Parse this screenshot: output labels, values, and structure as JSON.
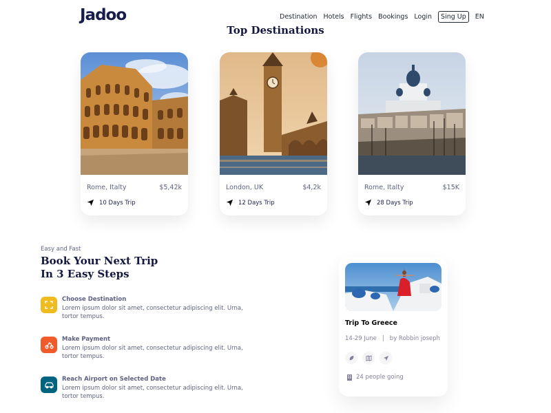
{
  "header": {
    "logo": "Jadoo",
    "nav": [
      "Destination",
      "Hotels",
      "Flights",
      "Bookings",
      "Login",
      "Sing Up",
      "EN"
    ]
  },
  "destinations": {
    "title": "Top Destinations",
    "cards": [
      {
        "place": "Rome, Italty",
        "price": "$5,42k",
        "trip": "10 Days Trip",
        "image": "colosseum"
      },
      {
        "place": "London, UK",
        "price": "$4,2k",
        "trip": "12 Days Trip",
        "image": "big-ben"
      },
      {
        "place": "Rome, Italty",
        "price": "$15K",
        "trip": "28 Days Trip",
        "image": "cathedral-harbor"
      }
    ]
  },
  "booking": {
    "eyebrow": "Easy and Fast",
    "title_line1": "Book Your Next Trip",
    "title_line2": "In 3 Easy Steps",
    "steps": [
      {
        "title": "Choose Destination",
        "text": "Lorem ipsum dolor sit amet, consectetur adipiscing elit. Urna, tortor tempus.",
        "color": "#F0BB1F",
        "icon": "selection-icon"
      },
      {
        "title": "Make Payment",
        "text": "Lorem ipsum dolor sit amet, consectetur adipiscing elit. Urna, tortor tempus.",
        "color": "#F15A2B",
        "icon": "payment-icon"
      },
      {
        "title": "Reach Airport on Selected Date",
        "text": "Lorem ipsum dolor sit amet, consectetur adipiscing elit. Urna, tortor tempus.",
        "color": "#006380",
        "icon": "taxi-icon"
      }
    ]
  },
  "trip_card": {
    "title": "Trip To Greece",
    "dates": "14-29 June",
    "separator": "|",
    "author": "by Robbin joseph",
    "going": "24 people going",
    "image": "santorini"
  },
  "colors": {
    "navy": "#181E4B",
    "accent": "#DF6951",
    "muted": "#5E6282"
  }
}
